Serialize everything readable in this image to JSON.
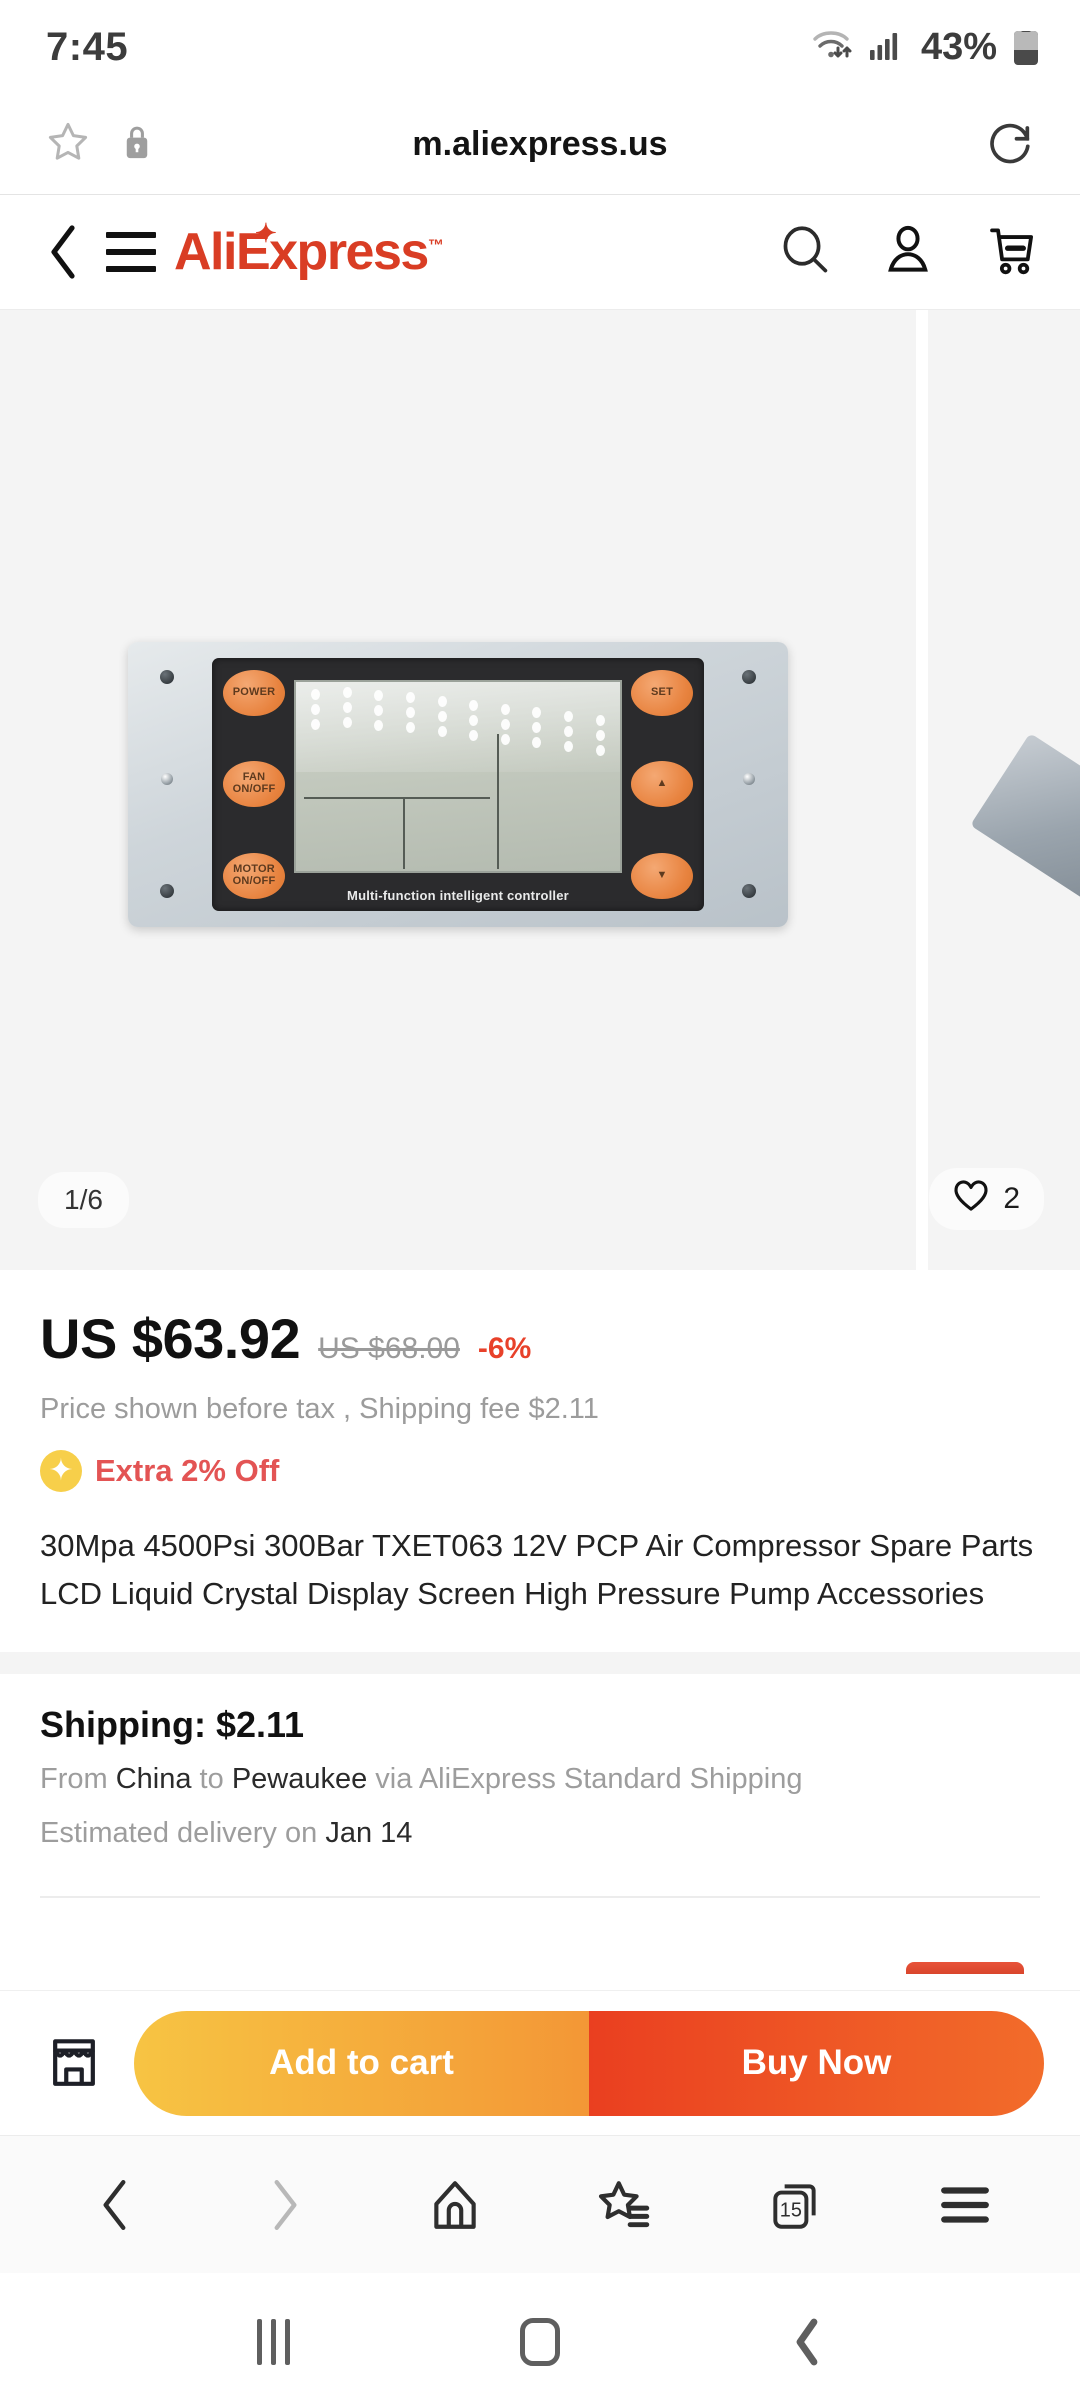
{
  "status_bar": {
    "time": "7:45",
    "battery_percent": "43%",
    "wifi_icon": "wifi-icon",
    "signal_icon": "cellular-signal-icon",
    "battery_icon": "battery-icon"
  },
  "browser": {
    "url": "m.aliexpress.us",
    "bookmark_icon": "star-outline-icon",
    "lock_icon": "lock-icon",
    "reload_icon": "reload-icon"
  },
  "site_header": {
    "back_icon": "chevron-left-icon",
    "menu_icon": "hamburger-menu-icon",
    "logo_text": "AliExpress",
    "logo_tm": "™",
    "logo_color": "#d93d24",
    "search_icon": "search-icon",
    "account_icon": "user-account-icon",
    "cart_icon": "shopping-cart-icon"
  },
  "gallery": {
    "counter": "1/6",
    "like_count": "2",
    "heart_icon": "heart-outline-icon",
    "device": {
      "caption": "Multi-function intelligent controller",
      "left_buttons": [
        "POWER",
        "FAN ON/OFF",
        "MOTOR ON/OFF"
      ],
      "right_buttons": [
        "SET",
        "▲",
        "▼"
      ],
      "button_color": "#e8833f"
    }
  },
  "price": {
    "current": "US $63.92",
    "original": "US $68.00",
    "discount": "-6%",
    "note": "Price shown before tax , Shipping fee $2.11",
    "extra_badge_icon": "sparkle-icon",
    "extra_label": "Extra 2% Off",
    "discount_color": "#e8412a",
    "extra_color": "#e35454"
  },
  "product": {
    "title": "30Mpa 4500Psi 300Bar TXET063 12V PCP Air Compressor Spare Parts LCD Liquid Crystal Display Screen High Pressure Pump Accessories"
  },
  "shipping": {
    "heading": "Shipping: $2.11",
    "from_prefix": "From ",
    "from_country": "China",
    "to_prefix": " to ",
    "to_city": "Pewaukee",
    "via": " via AliExpress Standard Shipping",
    "eta_prefix": "Estimated delivery on ",
    "eta_date": "Jan 14"
  },
  "cta": {
    "store_icon": "storefront-icon",
    "add_to_cart": "Add to cart",
    "buy_now": "Buy Now",
    "cart_color": "#f3a23a",
    "buy_color": "#ea3f20"
  },
  "browser_nav": {
    "back_icon": "chevron-left-icon",
    "forward_icon": "chevron-right-icon",
    "home_icon": "home-icon",
    "bookmarks_icon": "star-list-icon",
    "tabs_icon": "tabs-icon",
    "tabs_count": "15",
    "menu_icon": "hamburger-menu-icon"
  },
  "android_nav": {
    "recents_icon": "recents-icon",
    "home_icon": "home-circle-icon",
    "back_icon": "back-chevron-icon"
  }
}
